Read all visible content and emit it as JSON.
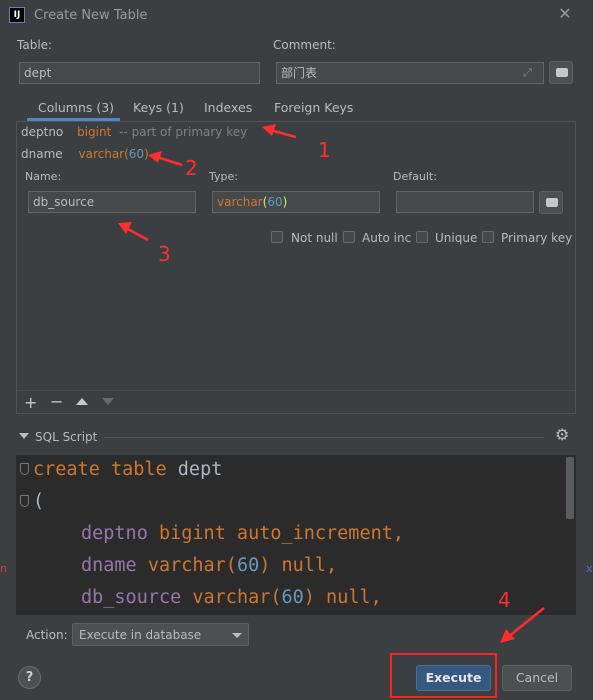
{
  "window": {
    "title": "Create New Table",
    "app_icon_text": "IJ"
  },
  "form": {
    "table_label": "Table:",
    "table_value": "dept",
    "comment_label": "Comment:",
    "comment_value": "部门表"
  },
  "tabs": [
    {
      "label": "Columns (3)",
      "selected": true
    },
    {
      "label": "Keys (1)",
      "selected": false
    },
    {
      "label": "Indexes",
      "selected": false
    },
    {
      "label": "Foreign Keys",
      "selected": false
    }
  ],
  "columns": [
    {
      "name": "deptno",
      "type": "bigint",
      "extra": "-- part of primary key"
    },
    {
      "name": "dname",
      "type_base": "varchar(",
      "type_len": "60",
      "type_close": ")"
    }
  ],
  "column_editor": {
    "name_label": "Name:",
    "name_value": "db_source",
    "type_label": "Type:",
    "type_base": "varchar",
    "type_open": "(",
    "type_len": "60",
    "type_close": ")",
    "default_label": "Default:",
    "default_value": "",
    "checkboxes": [
      {
        "label": "Not null",
        "checked": false
      },
      {
        "label": "Auto inc",
        "checked": false
      },
      {
        "label": "Unique",
        "checked": false
      },
      {
        "label": "Primary key",
        "checked": false
      }
    ]
  },
  "toolbar_icons": [
    "add-icon",
    "remove-icon",
    "move-up-icon",
    "move-down-icon"
  ],
  "sql": {
    "header": "SQL Script",
    "lines": {
      "l1_kw": "create table ",
      "l1_id": "dept",
      "l2": "(",
      "l3_col": "deptno",
      "l3_type": " bigint auto_increment,",
      "l4_col": "dname",
      "l4_type": " varchar(",
      "l4_num": "60",
      "l4_rest": ") null,",
      "l5_col": "db_source",
      "l5_type": " varchar(",
      "l5_num": "60",
      "l5_rest": ") null,"
    }
  },
  "action": {
    "label": "Action:",
    "selected": "Execute in database"
  },
  "buttons": {
    "help": "?",
    "execute": "Execute",
    "cancel": "Cancel"
  },
  "annotations": {
    "n1": "1",
    "n2": "2",
    "n3": "3",
    "n4": "4",
    "color": "#ff2d2d"
  },
  "colors": {
    "background": "#3c3f41",
    "editor_bg": "#2b2b2b",
    "accent": "#365880",
    "keyword": "#cc7832",
    "number": "#6897bb",
    "column": "#9876aa"
  }
}
